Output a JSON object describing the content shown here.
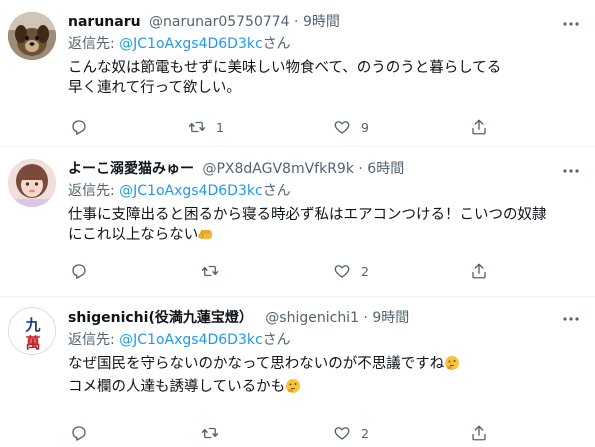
{
  "tweets": [
    {
      "name": "narunaru",
      "handle": "@narunar05750774",
      "dot": "·",
      "time": "9時間",
      "reply_prefix": "返信先:",
      "mention": "@JC1oAxgs4D6D3kc",
      "reply_suffix": "さん",
      "lines": [
        "こんな奴は節電もせずに美味しい物食べて、のうのうと暮らしてる",
        "早く連れて行って欲しい。"
      ],
      "counts": {
        "reply": "",
        "retweet": "1",
        "like": "9"
      },
      "avatar_icon": "dog-photo-avatar"
    },
    {
      "name": "よーこ溺愛猫みゅー",
      "handle": "@PX8dAGV8mVfkR9k",
      "dot": "·",
      "time": "6時間",
      "reply_prefix": "返信先:",
      "mention": "@JC1oAxgs4D6D3kc",
      "reply_suffix": "さん",
      "lines": [
        "仕事に支障出ると困るから寝る時必ず私はエアコンつける！こいつの奴隷",
        "にこれ以上ならない"
      ],
      "counts": {
        "reply": "",
        "retweet": "",
        "like": "2"
      },
      "avatar_icon": "person-photo-avatar",
      "trailing_emoji": "fist-emoji"
    },
    {
      "name": "shigenichi(役満九蓮宝燈）",
      "handle": "@shigenichi1",
      "dot": "·",
      "time": "9時間",
      "reply_prefix": "返信先:",
      "mention": "@JC1oAxgs4D6D3kc",
      "reply_suffix": "さん",
      "lines": [
        "なぜ国民を守らないのかなって思わないのが不思議ですね",
        "コメ欄の人達も誘導しているかも"
      ],
      "counts": {
        "reply": "",
        "retweet": "",
        "like": "2"
      },
      "avatar_icon": "mahjong-tile-avatar",
      "avatar_glyphs": [
        "九",
        "萬"
      ],
      "trailing_emoji": "thinking-emoji"
    }
  ],
  "colors": {
    "link": "#1d9bf0",
    "muted": "#536471",
    "text": "#0f1419",
    "divider": "#eff3f4"
  }
}
